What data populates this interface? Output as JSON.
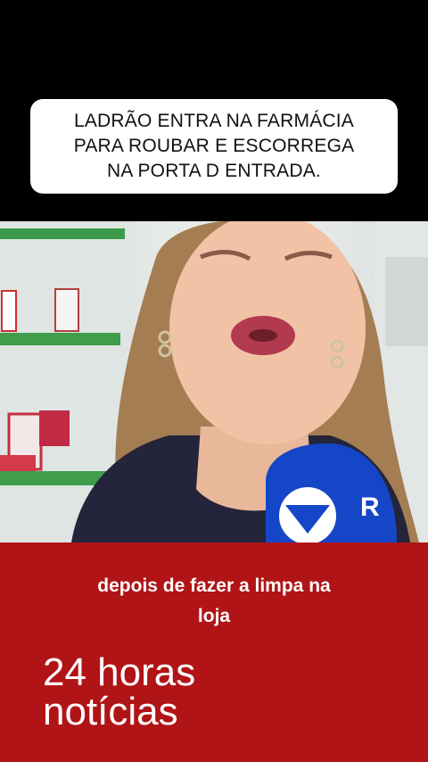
{
  "headline": {
    "text": "LADRÃO ENTRA NA FARMÁCIA\nPARA ROUBAR E ESCORREGA\nNA PORTA D ENTRADA."
  },
  "video": {
    "microphone_logo_text": "R"
  },
  "caption": {
    "line1": "depois de fazer a limpa na",
    "line2": "loja"
  },
  "brand": {
    "line1": "24 horas",
    "line2": "notícias"
  },
  "colors": {
    "background_top": "#000000",
    "headline_box": "#ffffff",
    "bottom_band": "#b11416",
    "mic_blue": "#1646c8",
    "lipstick": "#b23a4e"
  }
}
